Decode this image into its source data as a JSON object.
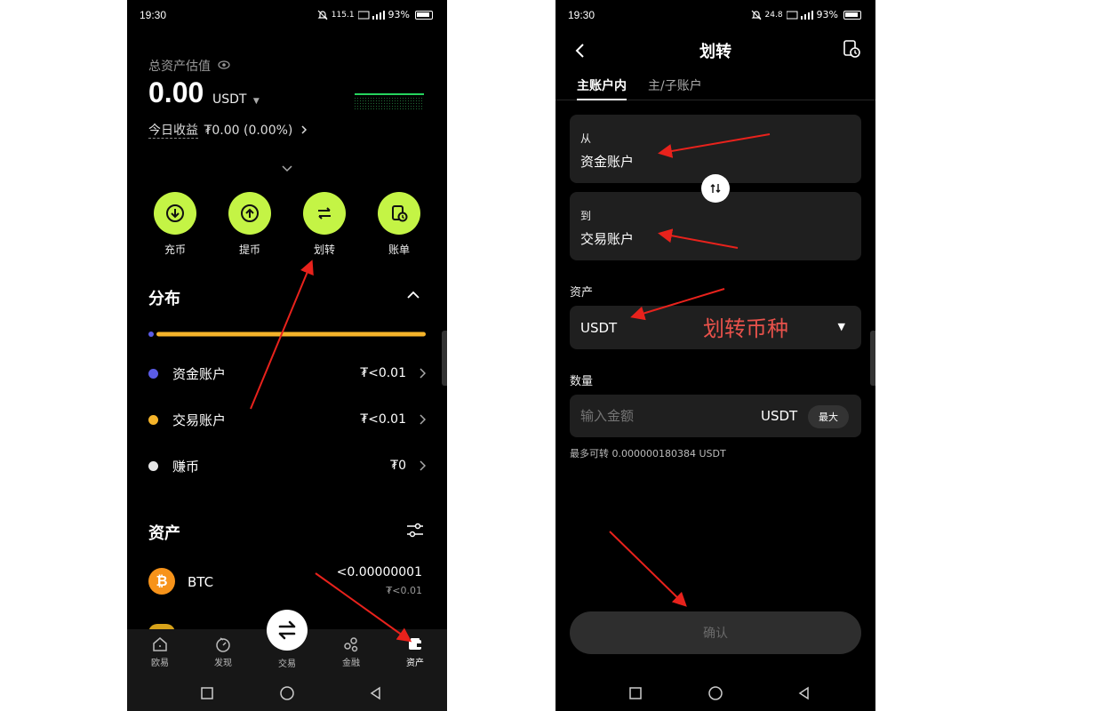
{
  "status": {
    "time": "19:30",
    "net_speed_left": "115.1",
    "net_speed_right": "24.8",
    "battery": "93%"
  },
  "overview": {
    "total_label": "总资产估值",
    "total_value": "0.00",
    "unit": "USDT",
    "today_label": "今日收益",
    "today_value": "₮0.00 (0.00%)"
  },
  "actions": [
    {
      "label": "充币",
      "icon": "deposit-icon"
    },
    {
      "label": "提币",
      "icon": "withdraw-icon"
    },
    {
      "label": "划转",
      "icon": "transfer-icon"
    },
    {
      "label": "账单",
      "icon": "bill-icon"
    }
  ],
  "distribution": {
    "title": "分布",
    "accounts": [
      {
        "name": "资金账户",
        "value": "₮<0.01",
        "color": "#5b5ce6"
      },
      {
        "name": "交易账户",
        "value": "₮<0.01",
        "color": "#f5b42a"
      },
      {
        "name": "赚币",
        "value": "₮0",
        "color": "#e6e6e6"
      }
    ]
  },
  "assets": {
    "title": "资产",
    "items": [
      {
        "symbol": "BTC",
        "amount": "<0.00000001",
        "value": "₮<0.01",
        "color": "#f7931a"
      }
    ]
  },
  "bottom_nav": [
    {
      "label": "欧易",
      "icon": "home-icon"
    },
    {
      "label": "发现",
      "icon": "discover-icon"
    },
    {
      "label": "交易",
      "icon": "trade-icon"
    },
    {
      "label": "金融",
      "icon": "finance-icon"
    },
    {
      "label": "资产",
      "icon": "wallet-icon"
    }
  ],
  "transfer": {
    "title": "划转",
    "tabs": [
      "主账户内",
      "主/子账户"
    ],
    "from_label": "从",
    "from_value": "资金账户",
    "to_label": "到",
    "to_value": "交易账户",
    "asset_label": "资产",
    "asset_value": "USDT",
    "asset_annotation": "划转币种",
    "amount_label": "数量",
    "amount_placeholder": "输入金额",
    "amount_unit": "USDT",
    "max_label": "最大",
    "max_available": "最多可转 0.000000180384 USDT",
    "confirm_label": "确认"
  },
  "colors": {
    "accent": "#c4f445",
    "annotation_red": "#e8221c",
    "card": "#1f1f1f"
  }
}
